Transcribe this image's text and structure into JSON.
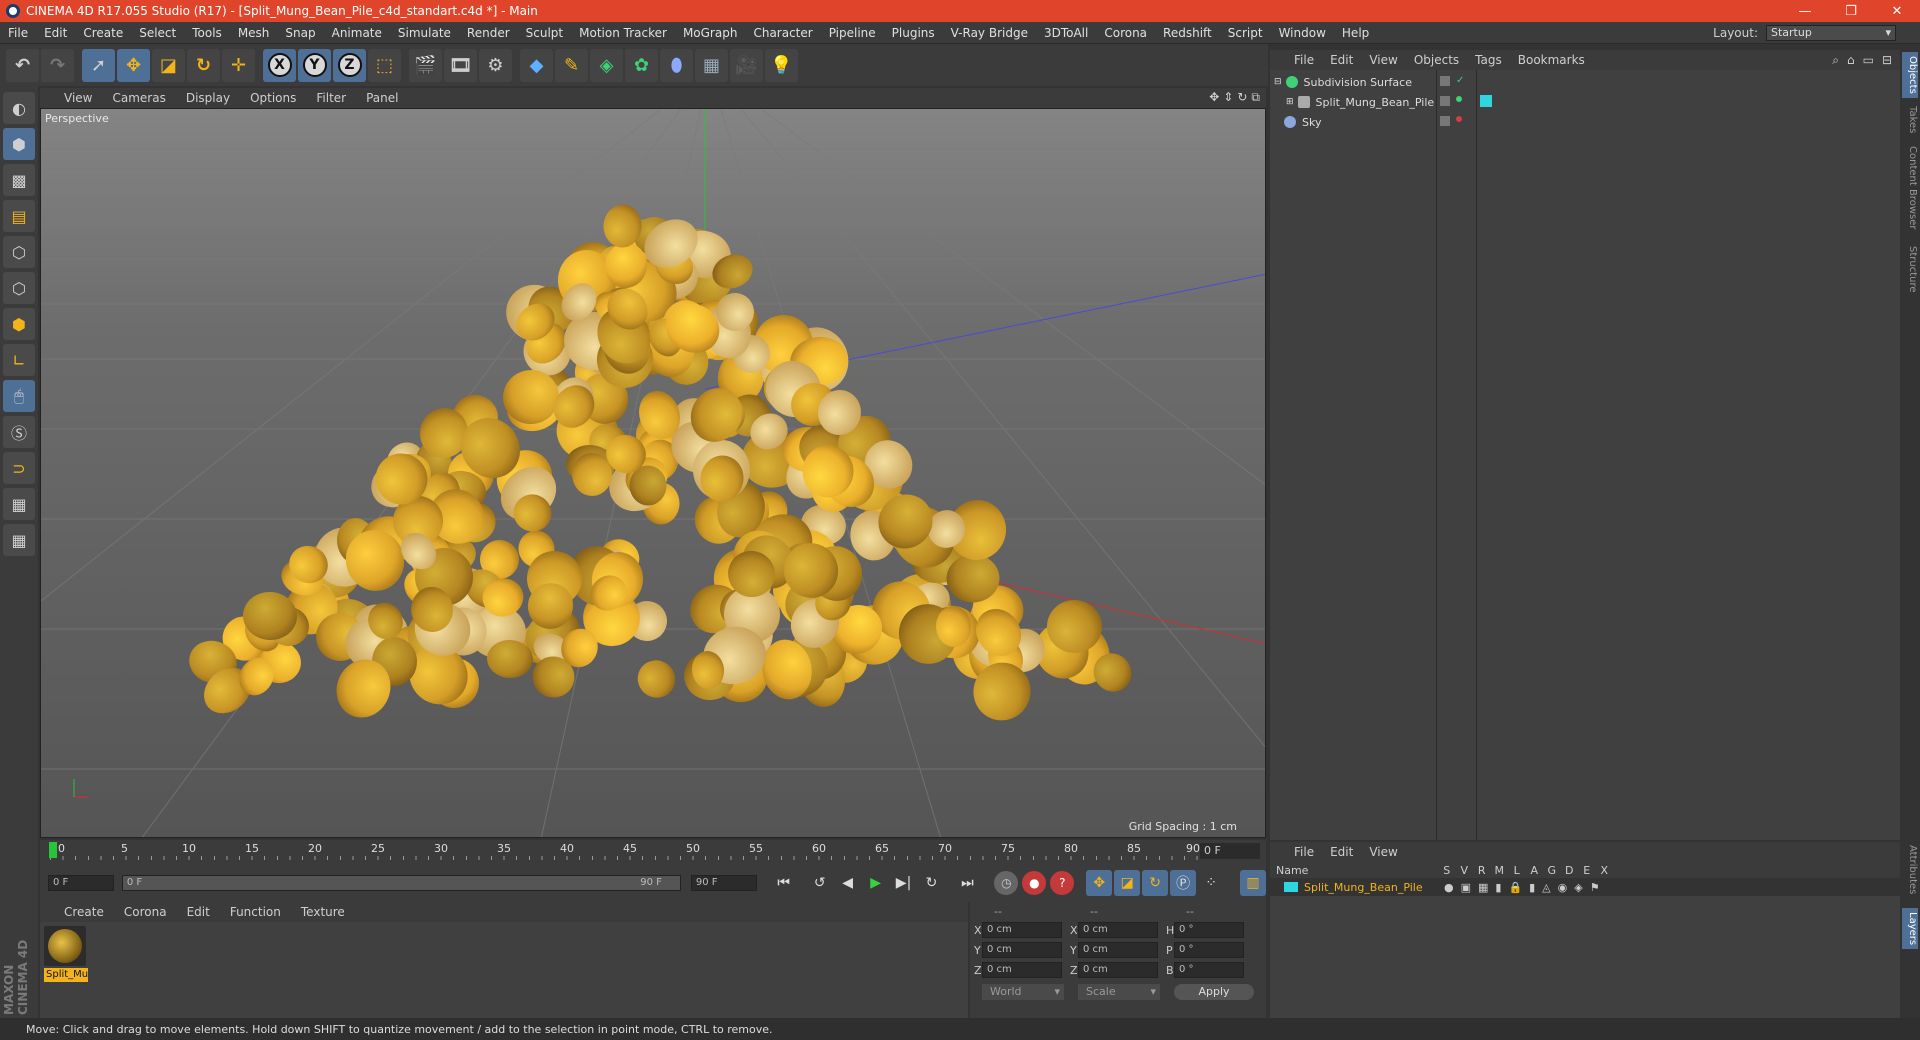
{
  "window": {
    "title": "CINEMA 4D R17.055 Studio (R17) - [Split_Mung_Bean_Pile_c4d_standart.c4d *] - Main",
    "controls": [
      "—",
      "❐",
      "✕"
    ]
  },
  "menubar": {
    "items": [
      "File",
      "Edit",
      "Create",
      "Select",
      "Tools",
      "Mesh",
      "Snap",
      "Animate",
      "Simulate",
      "Render",
      "Sculpt",
      "Motion Tracker",
      "MoGraph",
      "Character",
      "Pipeline",
      "Plugins",
      "V-Ray Bridge",
      "3DToAll",
      "Corona",
      "Redshift",
      "Script",
      "Window",
      "Help"
    ],
    "layout_label": "Layout:",
    "layout_value": "Startup"
  },
  "viewport": {
    "menu": [
      "View",
      "Cameras",
      "Display",
      "Options",
      "Filter",
      "Panel"
    ],
    "name": "Perspective",
    "grid_spacing": "Grid Spacing : 1 cm"
  },
  "timeline": {
    "ticks": [
      "0",
      "5",
      "10",
      "15",
      "20",
      "25",
      "30",
      "35",
      "40",
      "45",
      "50",
      "55",
      "60",
      "65",
      "70",
      "75",
      "80",
      "85",
      "90"
    ],
    "current_frame": "0 F",
    "start_field": "0 F",
    "range_start": "0 F",
    "range_end": "90 F",
    "end_field": "90 F"
  },
  "material_manager": {
    "menu": [
      "Create",
      "Corona",
      "Edit",
      "Function",
      "Texture"
    ],
    "material_name": "Split_Mu"
  },
  "coordinates": {
    "header": [
      "--",
      "--",
      "--"
    ],
    "rows": [
      {
        "a": "X",
        "av": "0 cm",
        "b": "X",
        "bv": "0 cm",
        "c": "H",
        "cv": "0 °"
      },
      {
        "a": "Y",
        "av": "0 cm",
        "b": "Y",
        "bv": "0 cm",
        "c": "P",
        "cv": "0 °"
      },
      {
        "a": "Z",
        "av": "0 cm",
        "b": "Z",
        "bv": "0 cm",
        "c": "B",
        "cv": "0 °"
      }
    ],
    "mode1": "World",
    "mode2": "Scale",
    "apply": "Apply"
  },
  "object_manager": {
    "menu": [
      "File",
      "Edit",
      "View",
      "Objects",
      "Tags",
      "Bookmarks"
    ],
    "objects": [
      "Subdivision Surface",
      "Split_Mung_Bean_Pile",
      "Sky"
    ]
  },
  "layer_manager": {
    "menu": [
      "File",
      "Edit",
      "View"
    ],
    "header_name": "Name",
    "header_cols": [
      "S",
      "V",
      "R",
      "M",
      "L",
      "A",
      "G",
      "D",
      "E",
      "X"
    ],
    "layer_name": "Split_Mung_Bean_Pile"
  },
  "side_tabs": [
    "Objects",
    "Takes",
    "Content Browser",
    "Structure",
    "Attributes",
    "Layers"
  ],
  "brand": "MAXON CINEMA 4D",
  "status": "Move: Click and drag to move elements. Hold down SHIFT to quantize movement / add to the selection in point mode, CTRL to remove.",
  "colors": {
    "titlebar": "#e0442a",
    "accent_blue": "#4e6f96",
    "bean_yellow": "#e3a92a",
    "layer_cyan": "#2ed6e0",
    "material_label": "#f2b31b"
  }
}
